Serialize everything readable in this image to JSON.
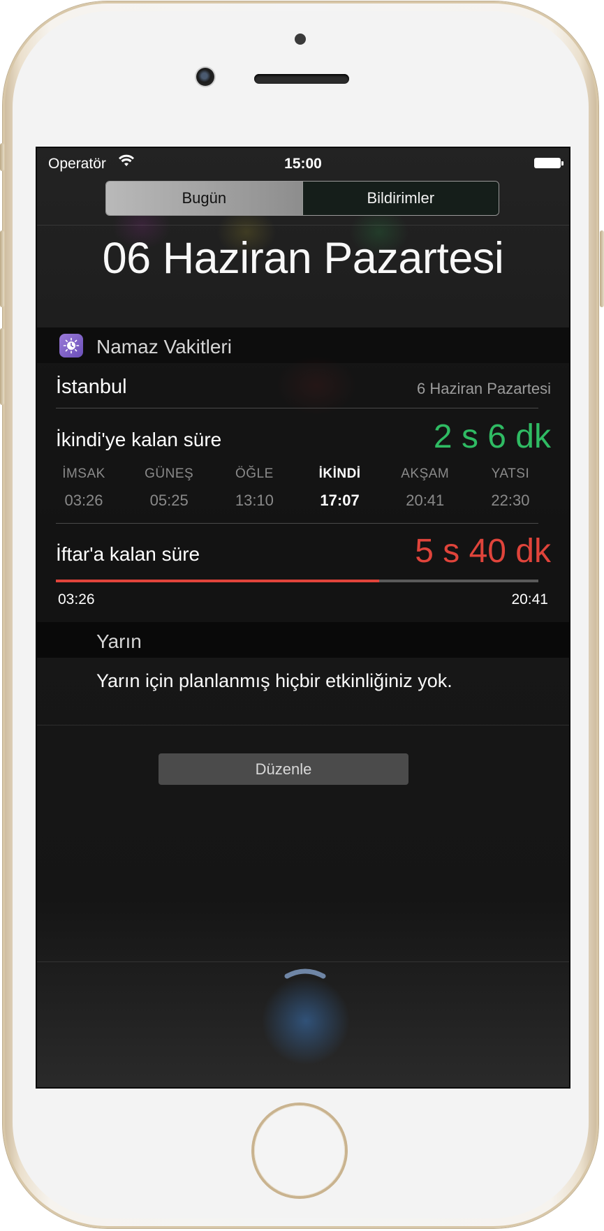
{
  "status_bar": {
    "carrier": "Operatör",
    "time": "15:00"
  },
  "segments": {
    "today": "Bugün",
    "notifications": "Bildirimler"
  },
  "date_heading": "06 Haziran Pazartesi",
  "widget": {
    "title": "Namaz Vakitleri",
    "city": "İstanbul",
    "date": "6 Haziran Pazartesi",
    "next_prayer": {
      "label": "İkindi'ye kalan süre",
      "value": "2 s 6 dk",
      "color": "#2fbb63"
    },
    "prayer_times": [
      {
        "name": "İMSAK",
        "time": "03:26",
        "current": false
      },
      {
        "name": "GÜNEŞ",
        "time": "05:25",
        "current": false
      },
      {
        "name": "ÖĞLE",
        "time": "13:10",
        "current": false
      },
      {
        "name": "İKİNDİ",
        "time": "17:07",
        "current": true
      },
      {
        "name": "AKŞAM",
        "time": "20:41",
        "current": false
      },
      {
        "name": "YATSI",
        "time": "22:30",
        "current": false
      }
    ],
    "iftar": {
      "label": "İftar'a kalan süre",
      "value": "5 s 40 dk",
      "color": "#e0443b",
      "start": "03:26",
      "end": "20:41",
      "progress": 0.67
    }
  },
  "tomorrow": {
    "title": "Yarın",
    "message": "Yarın için planlanmış hiçbir etkinliğiniz yok."
  },
  "edit_button": "Düzenle"
}
